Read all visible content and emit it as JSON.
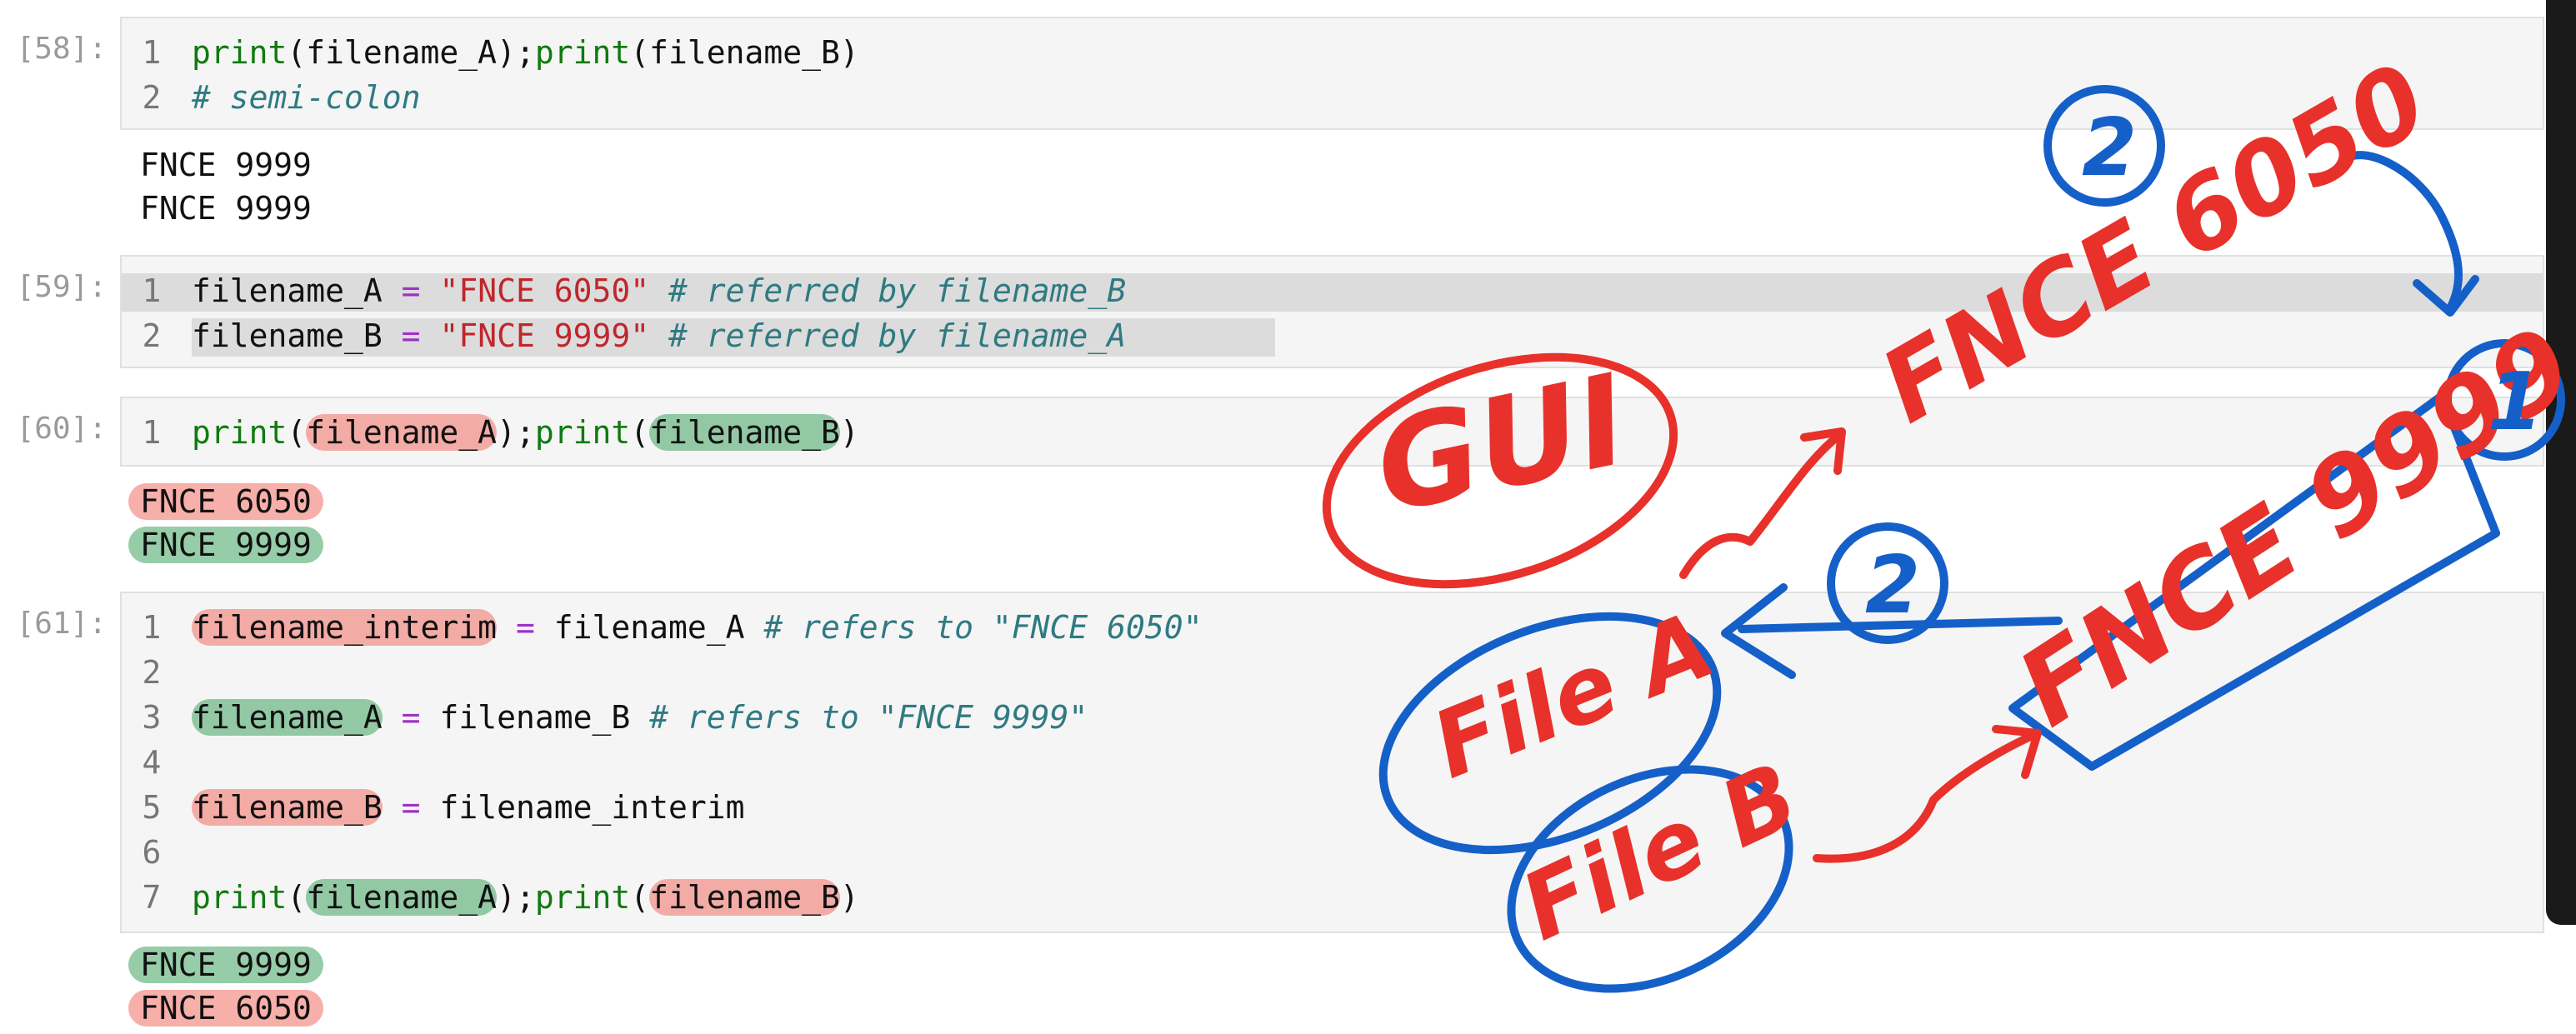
{
  "cells": [
    {
      "prompt": "[58]:",
      "lines": [
        {
          "num": "1",
          "parts": [
            {
              "t": "print",
              "c": "kw"
            },
            {
              "t": "(filename_A);"
            },
            {
              "t": "print",
              "c": "kw"
            },
            {
              "t": "(filename_B)"
            }
          ]
        },
        {
          "num": "2",
          "parts": [
            {
              "t": "# semi-colon",
              "c": "cmt"
            }
          ]
        }
      ],
      "output": [
        "FNCE 9999",
        "FNCE 9999"
      ]
    },
    {
      "prompt": "[59]:",
      "lines": [
        {
          "num": "1",
          "parts": [
            {
              "t": "filename_A "
            },
            {
              "t": "=",
              "c": "op"
            },
            {
              "t": " "
            },
            {
              "t": "\"FNCE 6050\"",
              "c": "str"
            },
            {
              "t": " "
            },
            {
              "t": "# referred by filename_B",
              "c": "cmt"
            }
          ]
        },
        {
          "num": "2",
          "parts": [
            {
              "t": "filename_B "
            },
            {
              "t": "=",
              "c": "op"
            },
            {
              "t": " "
            },
            {
              "t": "\"FNCE 9999\"",
              "c": "str"
            },
            {
              "t": " "
            },
            {
              "t": "# referred by filename_A",
              "c": "cmt"
            }
          ]
        }
      ]
    },
    {
      "prompt": "[60]:",
      "lines": [
        {
          "num": "1",
          "parts": [
            {
              "t": "print",
              "c": "kw"
            },
            {
              "t": "("
            },
            {
              "t": "filename_A",
              "h": "red"
            },
            {
              "t": ");"
            },
            {
              "t": "print",
              "c": "kw"
            },
            {
              "t": "("
            },
            {
              "t": "filename_B",
              "h": "green"
            },
            {
              "t": ")"
            }
          ]
        }
      ],
      "output": [
        {
          "t": "FNCE 6050",
          "h": "red"
        },
        {
          "t": "FNCE 9999",
          "h": "green"
        }
      ]
    },
    {
      "prompt": "[61]:",
      "lines": [
        {
          "num": "1",
          "parts": [
            {
              "t": "filename_interim",
              "h": "red"
            },
            {
              "t": " "
            },
            {
              "t": "=",
              "c": "op"
            },
            {
              "t": " filename_A "
            },
            {
              "t": "# refers to \"FNCE 6050\"",
              "c": "cmt"
            }
          ]
        },
        {
          "num": "2",
          "parts": []
        },
        {
          "num": "3",
          "parts": [
            {
              "t": "filename_A",
              "h": "green"
            },
            {
              "t": " "
            },
            {
              "t": "=",
              "c": "op"
            },
            {
              "t": " filename_B "
            },
            {
              "t": "# refers to \"FNCE 9999\"",
              "c": "cmt"
            }
          ]
        },
        {
          "num": "4",
          "parts": []
        },
        {
          "num": "5",
          "parts": [
            {
              "t": "filename_B",
              "h": "red"
            },
            {
              "t": " "
            },
            {
              "t": "=",
              "c": "op"
            },
            {
              "t": " filename_interim"
            }
          ]
        },
        {
          "num": "6",
          "parts": []
        },
        {
          "num": "7",
          "parts": [
            {
              "t": "print",
              "c": "kw"
            },
            {
              "t": "("
            },
            {
              "t": "filename_A",
              "h": "green"
            },
            {
              "t": ");"
            },
            {
              "t": "print",
              "c": "kw"
            },
            {
              "t": "("
            },
            {
              "t": "filename_B",
              "h": "red"
            },
            {
              "t": ")"
            }
          ]
        }
      ],
      "output": [
        {
          "t": "FNCE 9999",
          "h": "green"
        },
        {
          "t": "FNCE 6050",
          "h": "red"
        }
      ]
    }
  ],
  "annotations": {
    "gui": "GUI",
    "file_a": "File A",
    "file_b": "File B",
    "fnce_6050": "FNCE 6050",
    "fnce_9999": "FNCE 9999",
    "step_1": "1",
    "step_2a": "2",
    "step_2b": "2",
    "colors": {
      "red": "#e8312a",
      "blue": "#1560c8",
      "hl_red": "#f06e64",
      "hl_green": "#50aa6e"
    }
  },
  "icons": [
    "mute-icon",
    "mute-icon",
    "mute-icon",
    "mute-icon",
    "mute-icon"
  ]
}
